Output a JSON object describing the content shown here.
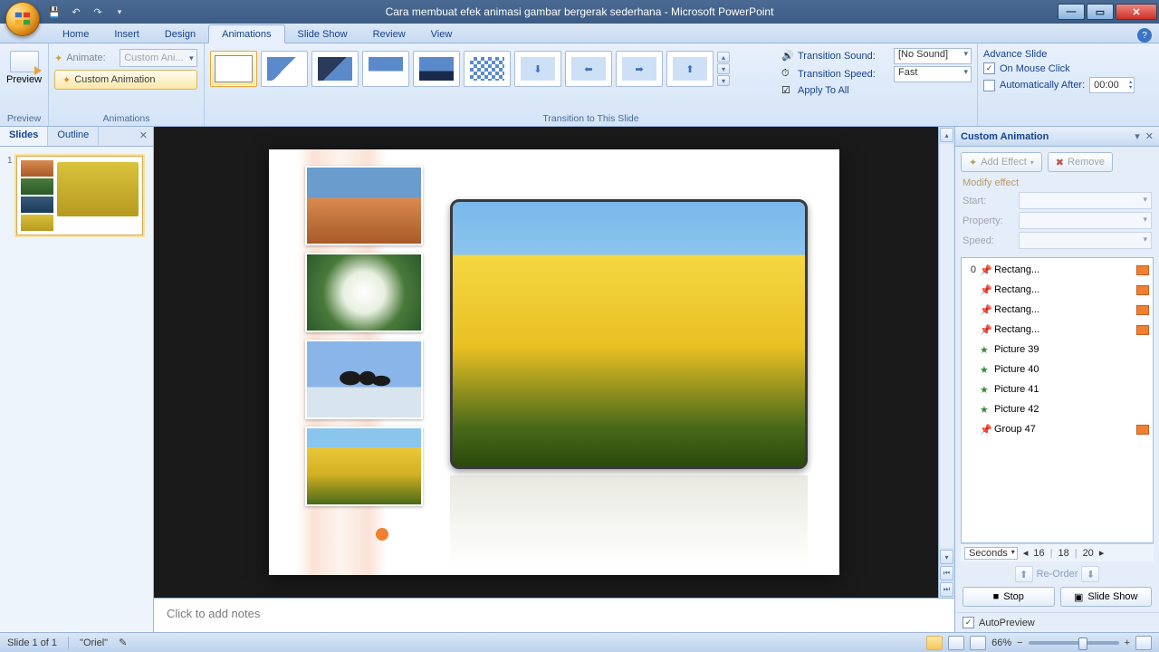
{
  "title": "Cara membuat efek animasi gambar bergerak sederhana - Microsoft PowerPoint",
  "tabs": {
    "home": "Home",
    "insert": "Insert",
    "design": "Design",
    "animations": "Animations",
    "slideshow": "Slide Show",
    "review": "Review",
    "view": "View"
  },
  "ribbon": {
    "preview_group": "Preview",
    "preview": "Preview",
    "animations_group": "Animations",
    "animate_label": "Animate:",
    "animate_value": "Custom Ani...",
    "custom_animation": "Custom Animation",
    "transition_group": "Transition to This Slide",
    "trans_sound": "Transition Sound:",
    "trans_sound_val": "[No Sound]",
    "trans_speed": "Transition Speed:",
    "trans_speed_val": "Fast",
    "apply_all": "Apply To All",
    "advance_hdr": "Advance Slide",
    "on_click": "On Mouse Click",
    "auto_after": "Automatically After:",
    "auto_after_val": "00:00"
  },
  "panes": {
    "slides": "Slides",
    "outline": "Outline",
    "custom_anim": "Custom Animation",
    "add_effect": "Add Effect",
    "remove": "Remove",
    "modify": "Modify effect",
    "start": "Start:",
    "property": "Property:",
    "speed": "Speed:",
    "seconds": "Seconds",
    "t1": "16",
    "t2": "18",
    "t3": "20",
    "reorder": "Re-Order",
    "stop": "Stop",
    "slideshow": "Slide Show",
    "autopreview": "AutoPreview"
  },
  "anim_items": [
    {
      "num": "0",
      "name": "Rectang...",
      "bar": true,
      "green": true
    },
    {
      "num": "",
      "name": "Rectang...",
      "bar": true,
      "green": true
    },
    {
      "num": "",
      "name": "Rectang...",
      "bar": true,
      "green": true
    },
    {
      "num": "",
      "name": "Rectang...",
      "bar": true,
      "green": true
    },
    {
      "num": "",
      "name": "Picture 39",
      "bar": false,
      "green": false
    },
    {
      "num": "",
      "name": "Picture 40",
      "bar": false,
      "green": false
    },
    {
      "num": "",
      "name": "Picture 41",
      "bar": false,
      "green": false
    },
    {
      "num": "",
      "name": "Picture 42",
      "bar": false,
      "green": false
    },
    {
      "num": "",
      "name": "Group 47",
      "bar": true,
      "green": true
    }
  ],
  "notes_placeholder": "Click to add notes",
  "status": {
    "slide": "Slide 1 of 1",
    "theme": "\"Oriel\"",
    "zoom": "66%"
  }
}
